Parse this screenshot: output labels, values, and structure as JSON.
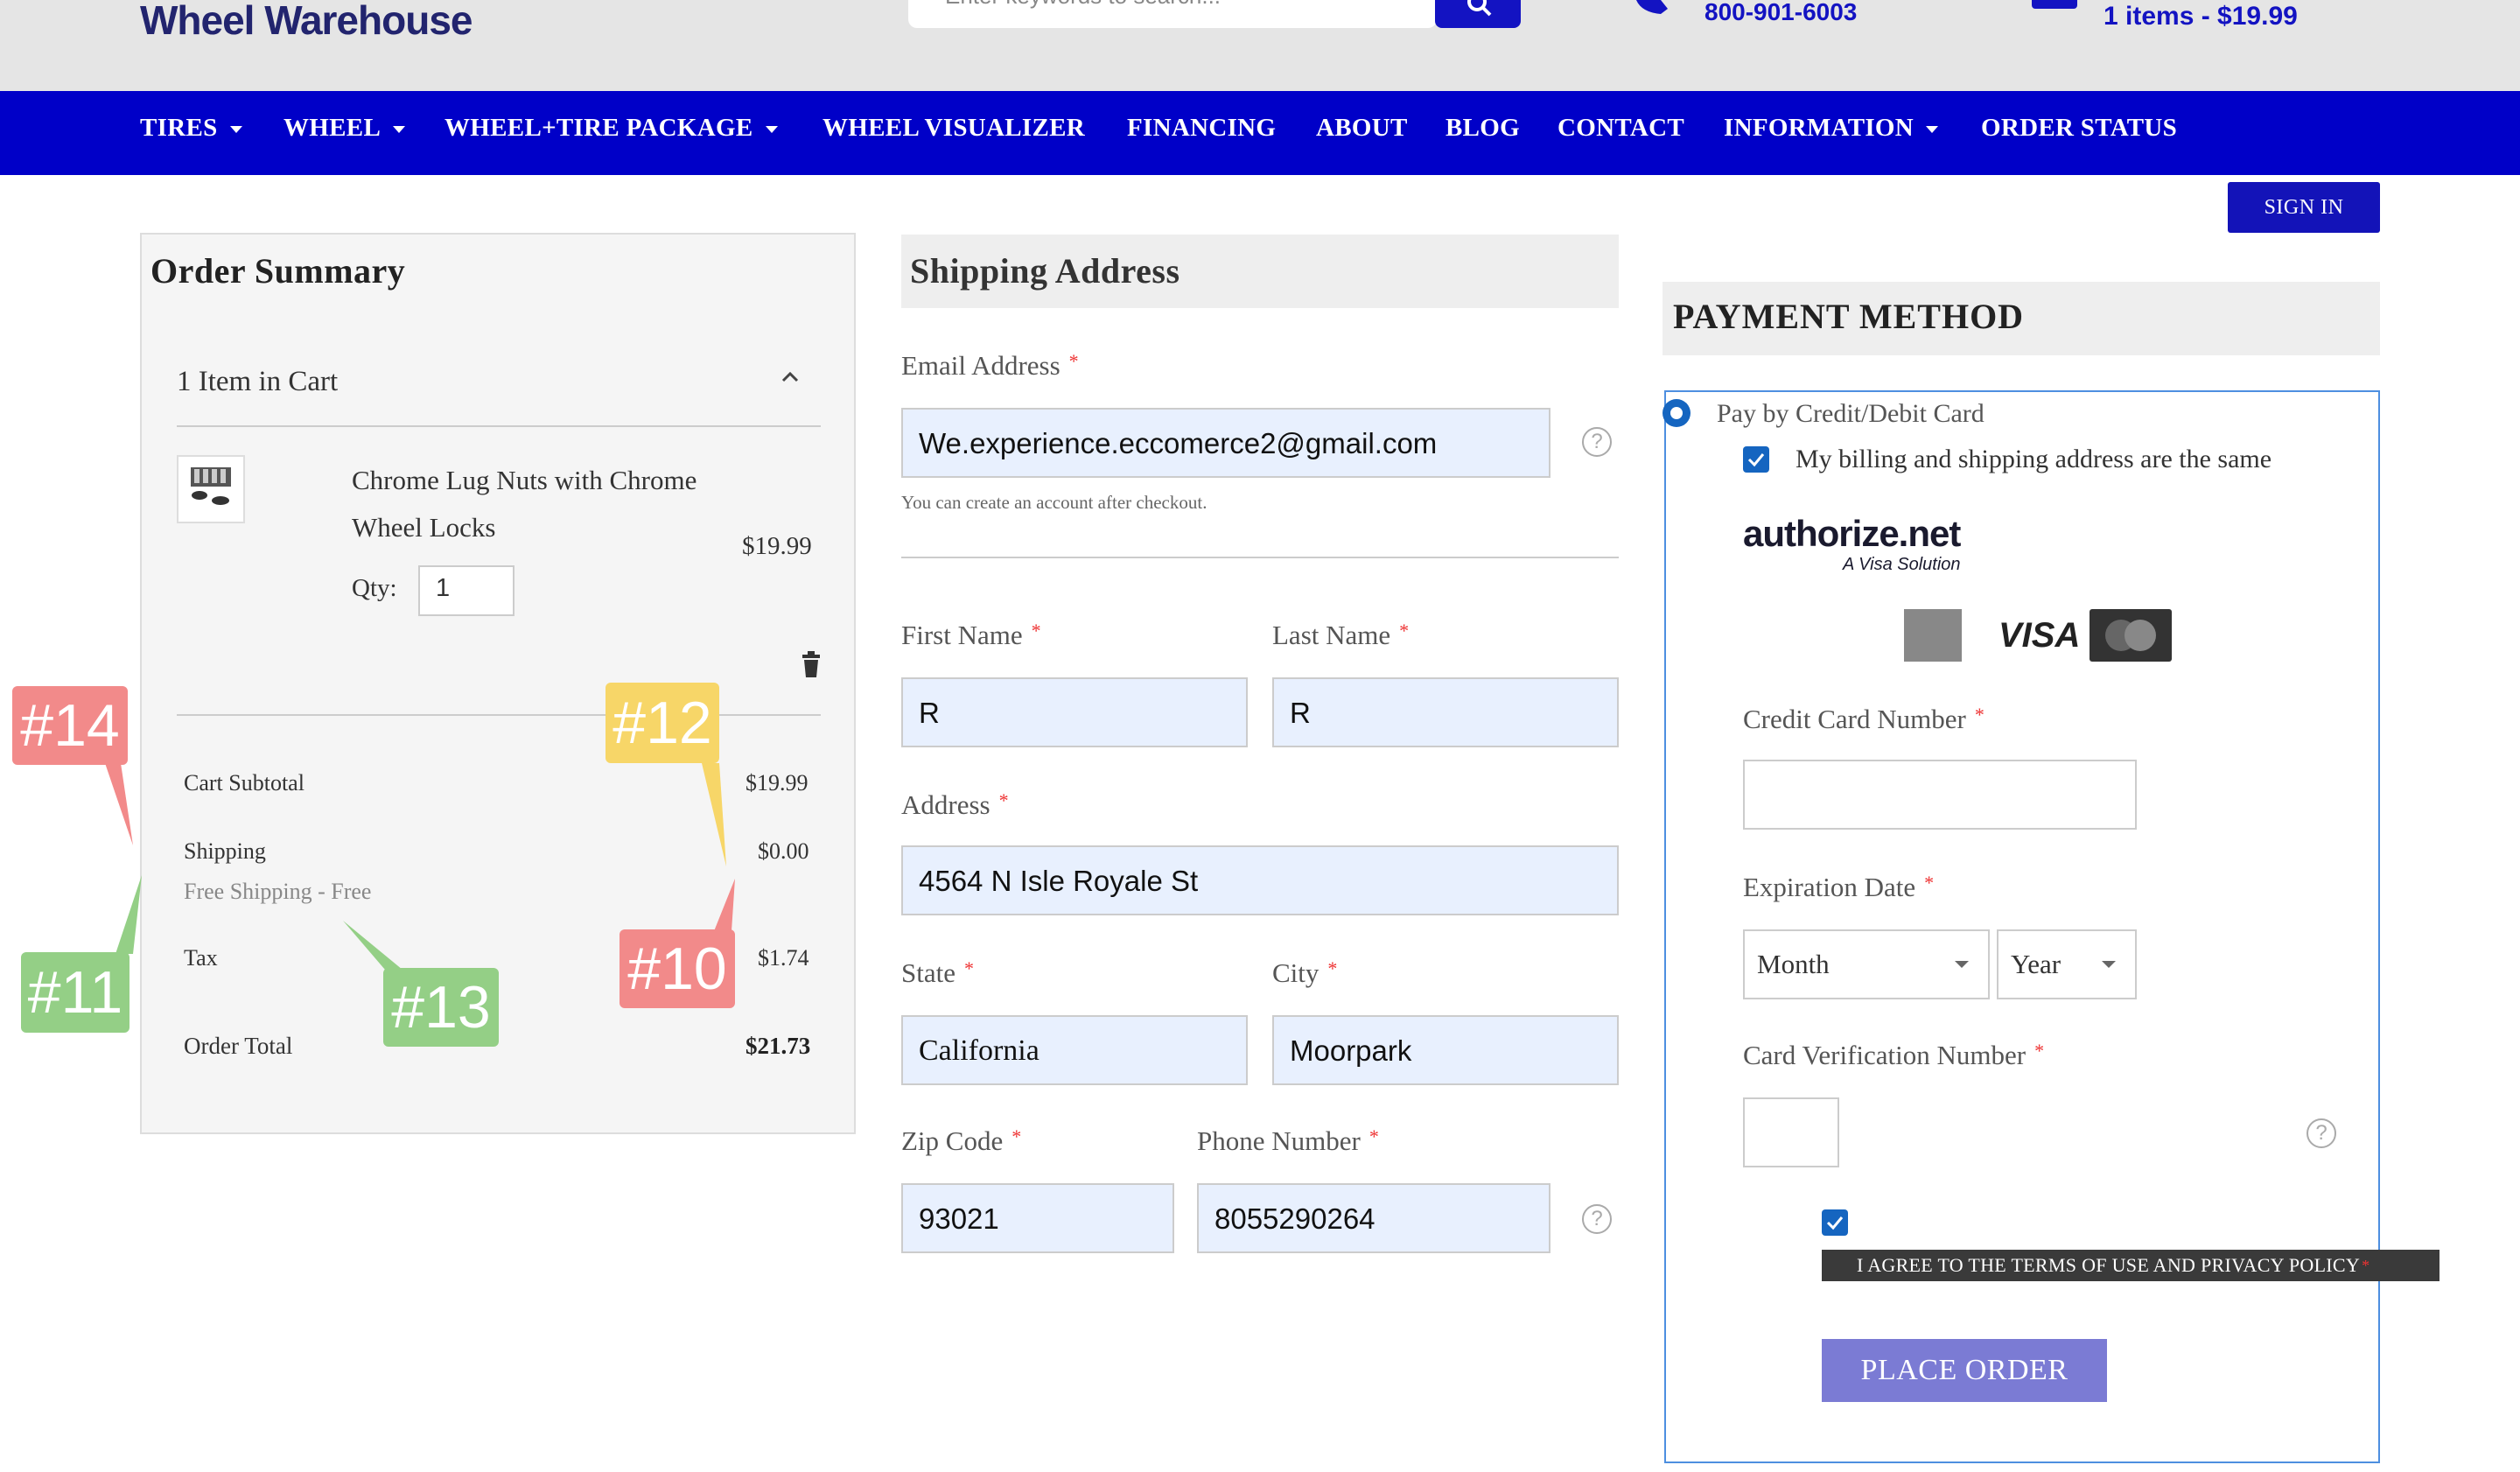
{
  "header": {
    "logo": "Wheel Warehouse",
    "search_placeholder": "Enter keywords to search...",
    "phone": "800-901-6003",
    "cart_summary": "1 items - $19.99"
  },
  "nav": {
    "items": [
      {
        "label": "TIRES",
        "dropdown": true
      },
      {
        "label": "WHEEL",
        "dropdown": true
      },
      {
        "label": "WHEEL+TIRE PACKAGE",
        "dropdown": true
      },
      {
        "label": "WHEEL VISUALIZER",
        "dropdown": false
      },
      {
        "label": "FINANCING",
        "dropdown": false
      },
      {
        "label": "ABOUT",
        "dropdown": false
      },
      {
        "label": "BLOG",
        "dropdown": false
      },
      {
        "label": "CONTACT",
        "dropdown": false
      },
      {
        "label": "INFORMATION",
        "dropdown": true
      },
      {
        "label": "ORDER STATUS",
        "dropdown": false
      }
    ],
    "sign_in": "SIGN IN"
  },
  "order_summary": {
    "title": "Order Summary",
    "items_label": "1 Item in Cart",
    "product": {
      "name": "Chrome Lug Nuts with Chrome Wheel Locks",
      "price": "$19.99",
      "qty_label": "Qty:",
      "qty": "1"
    },
    "subtotal_label": "Cart Subtotal",
    "subtotal": "$19.99",
    "shipping_label": "Shipping",
    "shipping_method": "Free Shipping - Free",
    "shipping": "$0.00",
    "tax_label": "Tax",
    "tax": "$1.74",
    "total_label": "Order Total",
    "total": "$21.73"
  },
  "shipping": {
    "title": "Shipping Address",
    "email_label": "Email Address",
    "email": "We.experience.eccomerce2@gmail.com",
    "email_hint": "You can create an account after checkout.",
    "first_name_label": "First Name",
    "first_name": "R",
    "last_name_label": "Last Name",
    "last_name": "R",
    "address_label": "Address",
    "address": "4564 N Isle Royale St",
    "state_label": "State",
    "state": "California",
    "city_label": "City",
    "city": "Moorpark",
    "zip_label": "Zip Code",
    "zip": "93021",
    "phone_label": "Phone Number",
    "phone": "8055290264",
    "required_mark": "*",
    "help_glyph": "?"
  },
  "payment": {
    "title": "PAYMENT METHOD",
    "option_label": "Pay by Credit/Debit Card",
    "billing_same_label": "My billing and shipping address are the same",
    "gateway_logo": "authorize.net",
    "gateway_sub": "A Visa Solution",
    "card_visa": "VISA",
    "card_number_label": "Credit Card Number",
    "expiration_label": "Expiration Date",
    "month": "Month",
    "year": "Year",
    "cvv_label": "Card Verification Number",
    "agree_label": "I AGREE TO THE TERMS OF USE AND PRIVACY POLICY",
    "place_order": "PLACE ORDER"
  },
  "annotations": {
    "b10": "#10",
    "b11": "#11",
    "b12": "#12",
    "b13": "#13",
    "b14": "#14"
  },
  "colors": {
    "nav_bg": "#0000c8",
    "brand_blue": "#1313c2",
    "logo": "#22246e",
    "input_fill": "#e8f0fe",
    "place_order": "#7b7bd4",
    "badge_red": "#f28a8a",
    "badge_yellow": "#f7d668",
    "badge_green": "#94cf86"
  }
}
